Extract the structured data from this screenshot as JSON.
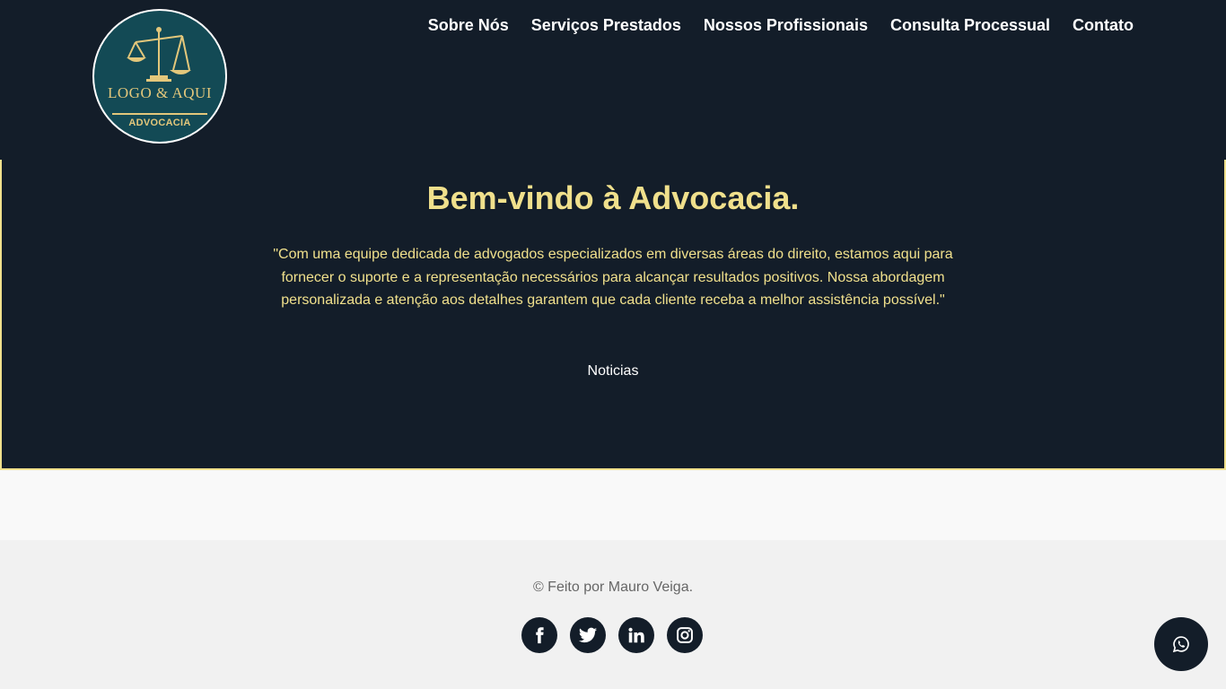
{
  "header": {
    "logo": {
      "icon": "scales-of-justice-icon",
      "main_text": "LOGO & AQUI",
      "sub_text": "ADVOCACIA"
    },
    "nav": [
      {
        "label": "Sobre Nós"
      },
      {
        "label": "Serviços Prestados"
      },
      {
        "label": "Nossos Profissionais"
      },
      {
        "label": "Consulta Processual"
      },
      {
        "label": "Contato"
      }
    ]
  },
  "hero": {
    "title": "Bem-vindo à Advocacia.",
    "quote": "\"Com uma equipe dedicada de advogados especializados em diversas áreas do direito, estamos aqui para fornecer o suporte e a representação necessários para alcançar resultados positivos. Nossa abordagem personalizada e atenção aos detalhes garantem que cada cliente receba a melhor assistência possível.\"",
    "news_label": "Noticias"
  },
  "footer": {
    "credit": "© Feito por Mauro Veiga.",
    "social": [
      "facebook-icon",
      "twitter-icon",
      "linkedin-icon",
      "instagram-icon"
    ]
  },
  "floating": {
    "whatsapp_icon": "whatsapp-icon"
  },
  "colors": {
    "navy": "#131d29",
    "gold": "#f0e08c",
    "logo_teal": "#134a55",
    "logo_gold": "#e3c77b"
  }
}
